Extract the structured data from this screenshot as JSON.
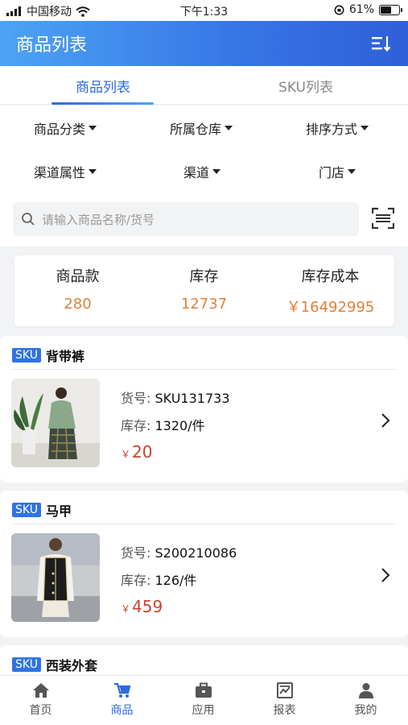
{
  "status_bar": {
    "carrier": "中国移动",
    "time": "下午1:33",
    "battery": "61%",
    "battery_level": 0.61
  },
  "header": {
    "title": "商品列表"
  },
  "tabs": [
    {
      "label": "商品列表",
      "active": true
    },
    {
      "label": "SKU列表",
      "active": false
    }
  ],
  "filters": [
    "商品分类",
    "所属仓库",
    "排序方式",
    "渠道属性",
    "渠道",
    "门店"
  ],
  "search": {
    "placeholder": "请输入商品名称/货号"
  },
  "summary": [
    {
      "label": "商品款",
      "value": "280"
    },
    {
      "label": "库存",
      "value": "12737"
    },
    {
      "label": "库存成本",
      "value": "￥16492995"
    }
  ],
  "products": [
    {
      "badge": "SKU",
      "name": "背带裤",
      "code_label": "货号:",
      "code": "SKU131733",
      "stock_label": "库存:",
      "stock": "1320/件",
      "currency": "￥",
      "price": "20"
    },
    {
      "badge": "SKU",
      "name": "马甲",
      "code_label": "货号:",
      "code": "S200210086",
      "stock_label": "库存:",
      "stock": "126/件",
      "currency": "￥",
      "price": "459"
    },
    {
      "badge": "SKU",
      "name": "西装外套"
    }
  ],
  "tabbar": [
    {
      "label": "首页",
      "icon": "home-icon",
      "active": false
    },
    {
      "label": "商品",
      "icon": "cart-icon",
      "active": true
    },
    {
      "label": "应用",
      "icon": "briefcase-icon",
      "active": false
    },
    {
      "label": "报表",
      "icon": "report-icon",
      "active": false
    },
    {
      "label": "我的",
      "icon": "user-icon",
      "active": false
    }
  ],
  "colors": {
    "accent": "#2c6ae0",
    "value": "#e0813a",
    "price": "#c9432f",
    "badge": "#2f73e4"
  }
}
